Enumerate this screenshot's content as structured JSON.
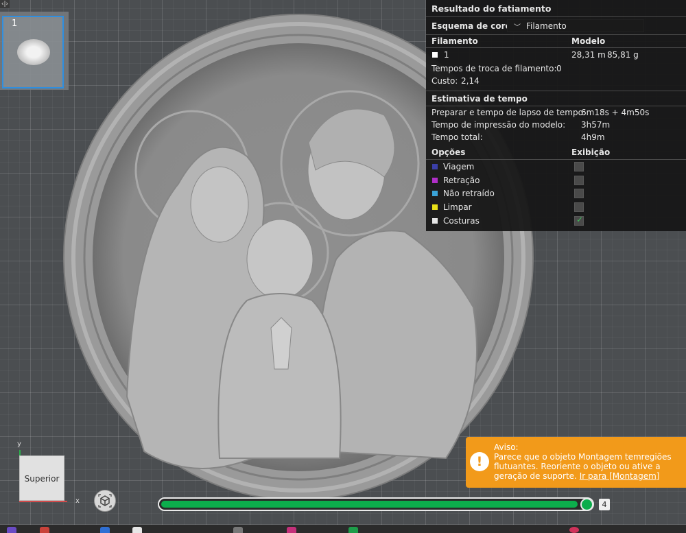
{
  "plate": {
    "number": "1"
  },
  "results": {
    "title": "Resultado do fatiamento",
    "color_scheme_label": "Esquema de cores",
    "color_scheme_value": "Filamento",
    "filament_header": "Filamento",
    "model_header": "Modelo",
    "filament_row": {
      "id": "1",
      "length": "28,31 m",
      "weight": "85,81 g"
    },
    "filament_change_label": "Tempos de troca de filamento:",
    "filament_change_value": "0",
    "cost_label": "Custo:",
    "cost_value": "2,14",
    "time_header": "Estimativa de tempo",
    "prep_label": "Preparar e tempo de lapso de tempo:",
    "prep_value": "6m18s + 4m50s",
    "print_label": "Tempo de impressão do modelo:",
    "print_value": "3h57m",
    "total_label": "Tempo total:",
    "total_value": "4h9m",
    "options_header": "Opções",
    "display_header": "Exibição",
    "options": [
      {
        "label": "Viagem",
        "color": "#3b3fa8",
        "checked": false
      },
      {
        "label": "Retração",
        "color": "#b02fc8",
        "checked": false
      },
      {
        "label": "Não retraído",
        "color": "#3aa3d8",
        "checked": false
      },
      {
        "label": "Limpar",
        "color": "#e8e018",
        "checked": false
      },
      {
        "label": "Costuras",
        "color": "#e6e6e6",
        "checked": true
      }
    ]
  },
  "view_cube": {
    "label": "Superior",
    "axis_y": "y",
    "axis_x": "x"
  },
  "slider": {
    "value": "4",
    "fill_fraction": 0.97
  },
  "warning": {
    "title": "Aviso:",
    "message": "Parece que o objeto Montagem temregiões flutuantes. Reoriente o objeto ou ative a geração de suporte.",
    "link": "Ir para [Montagem]"
  }
}
